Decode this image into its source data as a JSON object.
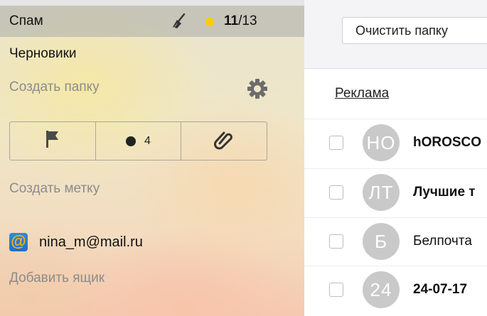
{
  "sidebar": {
    "spam": {
      "label": "Спам",
      "unread": "11",
      "separator": "/",
      "total": "13"
    },
    "drafts": {
      "label": "Черновики"
    },
    "create_folder": "Создать папку",
    "filters": {
      "unread_count": "4"
    },
    "create_label": "Создать метку",
    "account": {
      "email": "nina_m@mail.ru"
    },
    "add_mailbox": "Добавить ящик"
  },
  "main": {
    "clear_button": "Очистить папку",
    "ad_link": "Реклама",
    "messages": [
      {
        "avatar": "НО",
        "sender": "hOROSCO",
        "bold": true
      },
      {
        "avatar": "ЛТ",
        "sender": "Лучшие т",
        "bold": true
      },
      {
        "avatar": "Б",
        "sender": "Белпочта",
        "bold": false
      },
      {
        "avatar": "24",
        "sender": "24-07-17",
        "bold": true
      }
    ]
  },
  "colors": {
    "unread_dot": "#ffcc00",
    "avatar_bg": "#c9c9c9",
    "mail_logo": "#1f6fc7"
  }
}
